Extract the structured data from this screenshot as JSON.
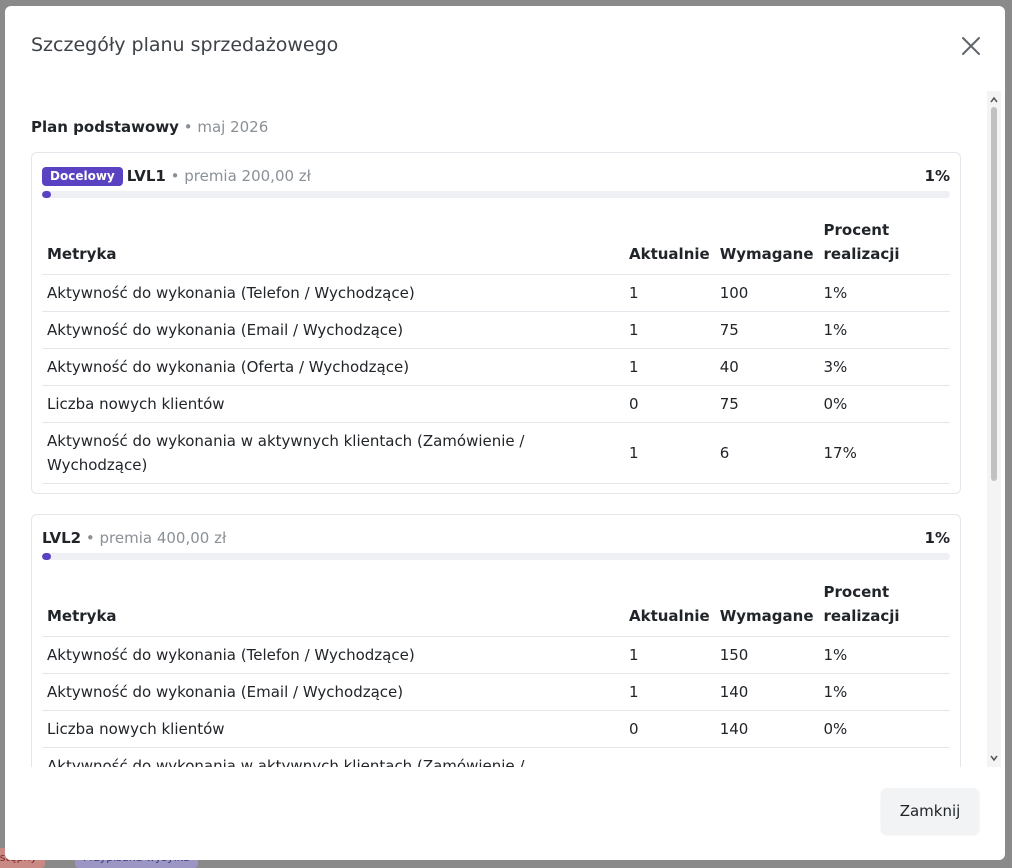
{
  "background": {
    "badge_left": "Niedostępny",
    "badge_right": "Przypisana wysyłka"
  },
  "modal": {
    "title": "Szczegóły planu sprzedażowego",
    "close_icon": "close-icon",
    "plan": {
      "name": "Plan podstawowy",
      "separator": " • ",
      "period": "maj 2026"
    },
    "columns": [
      "Metryka",
      "Aktualnie",
      "Wymagane",
      "Procent realizacji"
    ],
    "levels": [
      {
        "badge": "Docelowy",
        "name": "LVL1",
        "meta": " • premia 200,00 zł",
        "percent_label": "1%",
        "progress": 0.01,
        "rows": [
          [
            "Aktywność do wykonania (Telefon / Wychodzące)",
            "1",
            "100",
            "1%"
          ],
          [
            "Aktywność do wykonania (Email / Wychodzące)",
            "1",
            "75",
            "1%"
          ],
          [
            "Aktywność do wykonania (Oferta / Wychodzące)",
            "1",
            "40",
            "3%"
          ],
          [
            "Liczba nowych klientów",
            "0",
            "75",
            "0%"
          ],
          [
            "Aktywność do wykonania w aktywnych klientach (Zamówienie / Wychodzące)",
            "1",
            "6",
            "17%"
          ]
        ]
      },
      {
        "badge": "",
        "name": "LVL2",
        "meta": " • premia 400,00 zł",
        "percent_label": "1%",
        "progress": 0.01,
        "rows": [
          [
            "Aktywność do wykonania (Telefon / Wychodzące)",
            "1",
            "150",
            "1%"
          ],
          [
            "Aktywność do wykonania (Email / Wychodzące)",
            "1",
            "140",
            "1%"
          ],
          [
            "Liczba nowych klientów",
            "0",
            "140",
            "0%"
          ],
          [
            "Aktywność do wykonania w aktywnych klientach (Zamówienie / Wychodzące)",
            "",
            "",
            ""
          ]
        ]
      }
    ],
    "close_button": "Zamknij"
  },
  "colors": {
    "accent": "#5a42c2",
    "track": "#eef0f3",
    "muted_text": "#8a9096"
  }
}
